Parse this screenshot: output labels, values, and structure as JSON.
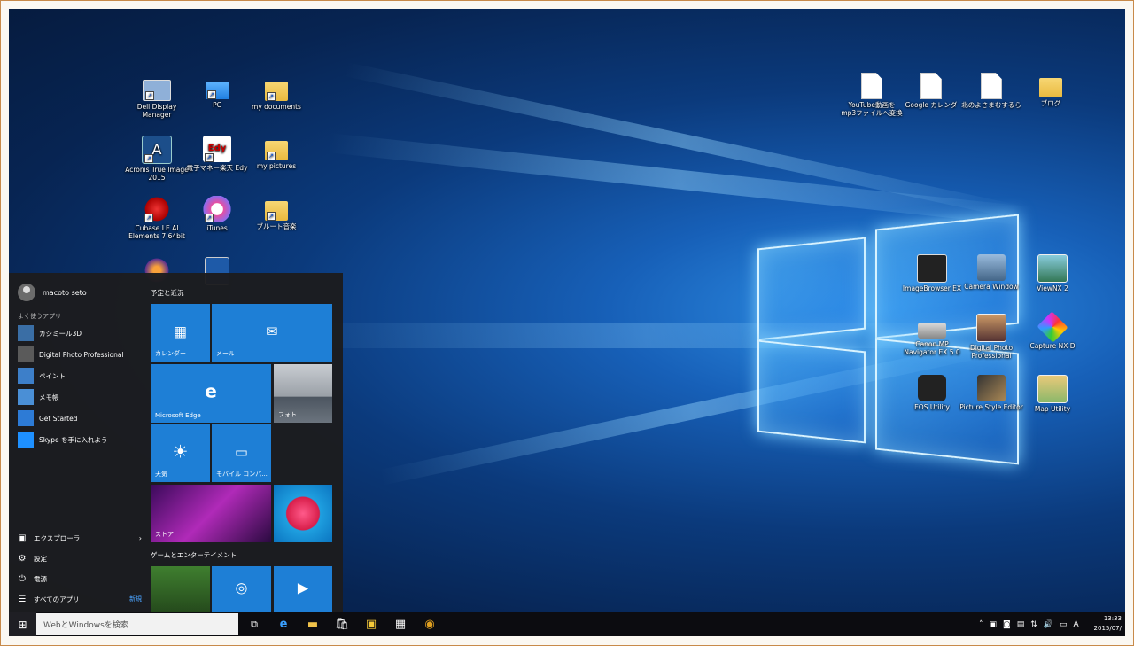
{
  "desktop": {
    "icons_left": [
      {
        "label": "Dell Display Manager",
        "icon": "monitor-icon"
      },
      {
        "label": "PC",
        "icon": "computer-icon"
      },
      {
        "label": "my documents",
        "icon": "folder-doc-icon"
      },
      {
        "label": "Acronis True Image 2015",
        "icon": "acronis-icon"
      },
      {
        "label": "電子マネー楽天 Edy",
        "icon": "edy-icon"
      },
      {
        "label": "my pictures",
        "icon": "folder-picture-icon"
      },
      {
        "label": "Cubase LE AI Elements 7 64bit",
        "icon": "cubase-icon"
      },
      {
        "label": "iTunes",
        "icon": "itunes-icon"
      },
      {
        "label": "ブルート音楽",
        "icon": "folder-icon"
      }
    ],
    "icons_right_top": [
      {
        "label": "YouTube動画を mp3ファイルへ変換",
        "icon": "document-icon"
      },
      {
        "label": "Google カレンダ",
        "icon": "document-icon"
      },
      {
        "label": "北のよさまむするら",
        "icon": "document-icon"
      },
      {
        "label": "ブログ",
        "icon": "folder-icon"
      }
    ],
    "icons_right_logo": [
      {
        "label": "ImageBrowser EX",
        "icon": "camera-app-icon"
      },
      {
        "label": "Camera Window",
        "icon": "camera-window-icon"
      },
      {
        "label": "ViewNX 2",
        "icon": "viewnx-icon"
      },
      {
        "label": "Canon MP Navigator EX 5.0",
        "icon": "scanner-icon"
      },
      {
        "label": "Digital Photo Professional",
        "icon": "photo-pro-icon"
      },
      {
        "label": "Capture NX-D",
        "icon": "capture-nx-icon"
      },
      {
        "label": "EOS Utility",
        "icon": "eos-camera-icon"
      },
      {
        "label": "Picture Style Editor",
        "icon": "picture-style-icon"
      },
      {
        "label": "Map Utility",
        "icon": "map-icon"
      }
    ]
  },
  "start_menu": {
    "user_name": "macoto seto",
    "most_used_title": "よく使うアプリ",
    "apps": [
      {
        "label": "カシミール3D",
        "color": "#3a6ea5"
      },
      {
        "label": "Digital Photo Professional",
        "color": "#5a5a5a"
      },
      {
        "label": "ペイント",
        "color": "#3d7fc9"
      },
      {
        "label": "メモ帳",
        "color": "#4a8fd6"
      },
      {
        "label": "Get Started",
        "color": "#2d7bd6"
      },
      {
        "label": "Skype を手に入れよう",
        "color": "#1e90ff"
      }
    ],
    "bottom": [
      {
        "label": "エクスプローラ",
        "glyph": "▣"
      },
      {
        "label": "設定",
        "glyph": "⚙"
      },
      {
        "label": "電源",
        "glyph": "⏻"
      },
      {
        "label": "すべてのアプリ",
        "glyph": "☰"
      }
    ],
    "new_badge": "新規",
    "tiles_heading_1": "予定と近況",
    "tiles_heading_2": "ゲームとエンターテイメント",
    "tiles": {
      "calendar": "カレンダー",
      "mail": "メール",
      "edge": "Microsoft Edge",
      "photos": "フォト",
      "weather": "天気",
      "phone": "モバイル コンパ...",
      "store": "ストア"
    }
  },
  "taskbar": {
    "search_placeholder": "WebとWindowsを検索",
    "clock_time": "13:33",
    "clock_date": "2015/07/",
    "ime": "A"
  }
}
